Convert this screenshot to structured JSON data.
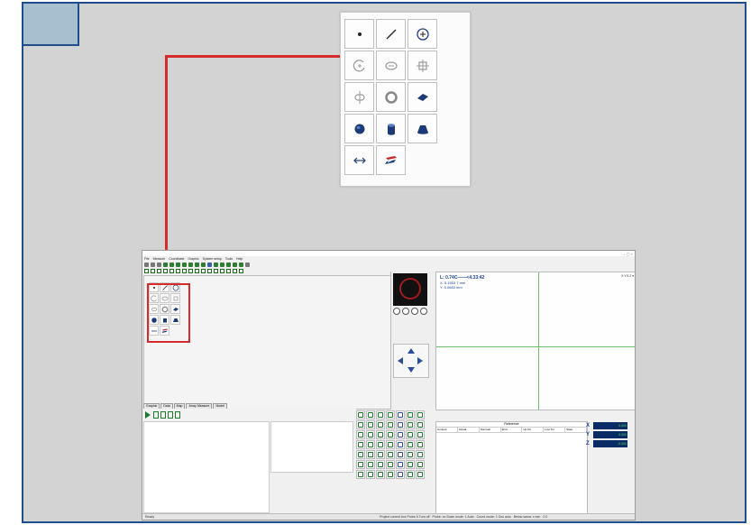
{
  "colors": {
    "frame_border": "#1f4e8c",
    "frame_bg": "#d3d3d3",
    "highlight_red": "#d62b2b",
    "corner_tab": "#a8bfd0"
  },
  "palette": {
    "buttons": [
      {
        "icon": "point-icon"
      },
      {
        "icon": "line-icon"
      },
      {
        "icon": "circle-center-icon"
      },
      {
        "icon": "arc-icon"
      },
      {
        "icon": "ellipse-icon"
      },
      {
        "icon": "slot-icon"
      },
      {
        "icon": "keyhole-icon"
      },
      {
        "icon": "ring-icon"
      },
      {
        "icon": "plane-icon"
      },
      {
        "icon": "sphere-icon"
      },
      {
        "icon": "cylinder-icon"
      },
      {
        "icon": "cone-icon"
      },
      {
        "icon": "distance-icon"
      },
      {
        "icon": "stack-plane-icon"
      }
    ]
  },
  "app": {
    "title": "",
    "window_controls": "– ▢ ×",
    "menu": [
      "File",
      "Measure",
      "Coordinate",
      "Graphic",
      "System setup",
      "Tools",
      "Help"
    ],
    "readout": {
      "line1": "L: 0.74C——<4.33:42",
      "line2": "X: 5.1553 7 mm",
      "line3": "Y: 5.0683 mm"
    },
    "topright": "X:Y:5.2 ▾",
    "tabs": [
      "Graphic",
      "Data",
      "Map",
      "Array Measure",
      "Model"
    ],
    "data_table": {
      "title": "Reference",
      "columns": [
        "Content",
        "Actual",
        "Nominal",
        "Error",
        "Up Tol",
        "Low Tol",
        "State"
      ]
    },
    "xyz": [
      {
        "axis": "X",
        "value": "0.000"
      },
      {
        "axis": "Y",
        "value": "0.000"
      },
      {
        "axis": "Z",
        "value": "-0.000"
      }
    ],
    "status": {
      "left": "Ready",
      "mid1": "Project current box Probe 5 Turn off",
      "mid2": "Probe: xx  Scale mode: 1 Auto",
      "right1": "Coord mode: 1  Occ auto",
      "right2": "Below sama: x mm",
      "right3": "0.0"
    }
  }
}
